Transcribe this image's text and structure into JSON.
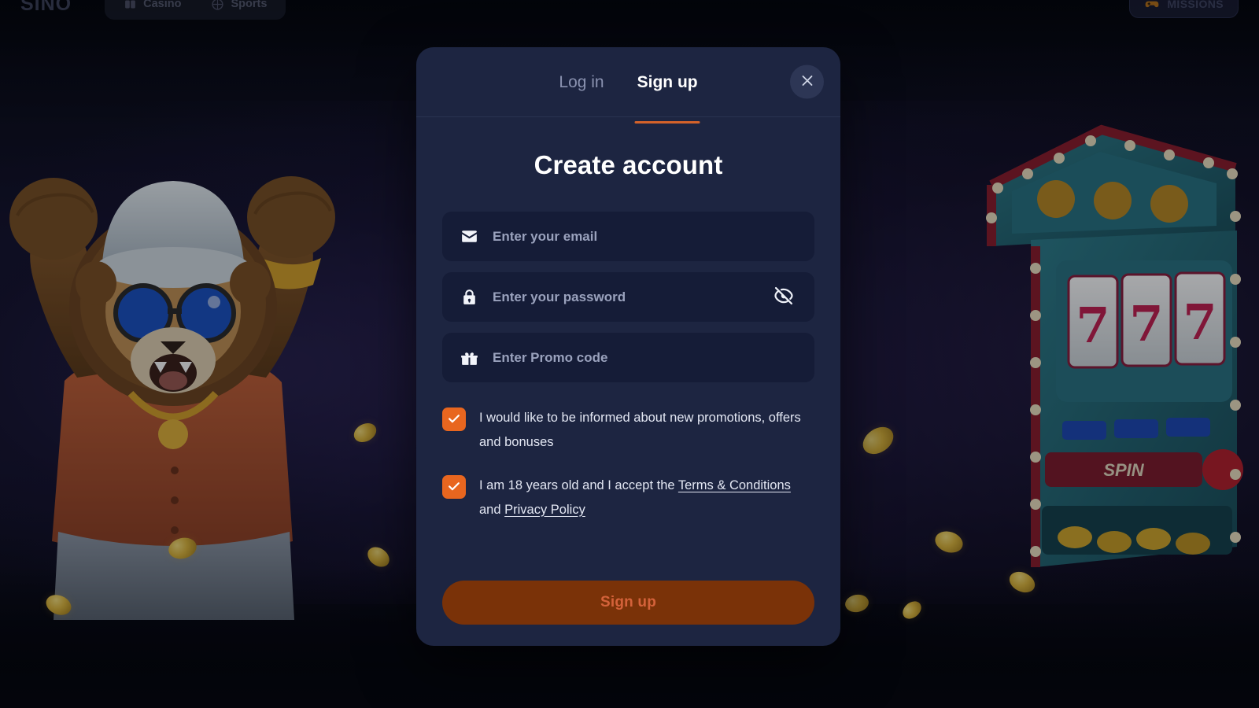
{
  "topnav": {
    "brand": "SINO",
    "items": [
      {
        "label": "Casino",
        "icon": "cards-icon"
      },
      {
        "label": "Sports",
        "icon": "ball-icon"
      }
    ],
    "missions": {
      "label": "MISSIONS",
      "icon": "gamepad-icon"
    }
  },
  "modal": {
    "tabs": [
      {
        "label": "Log in",
        "active": false
      },
      {
        "label": "Sign up",
        "active": true
      }
    ],
    "close_icon": "close-icon",
    "title": "Create account",
    "fields": [
      {
        "name": "email",
        "icon": "envelope-icon",
        "placeholder": "Enter your email",
        "value": ""
      },
      {
        "name": "password",
        "icon": "lock-icon",
        "placeholder": "Enter your password",
        "value": "",
        "toggle_icon": "eye-off-icon"
      },
      {
        "name": "promo",
        "icon": "gift-icon",
        "placeholder": "Enter Promo code",
        "value": ""
      }
    ],
    "consents": [
      {
        "checked": true,
        "text": "I would like to be informed about new promotions, offers and bonuses"
      },
      {
        "checked": true,
        "prefix": "I am 18 years old and I accept the ",
        "link1": "Terms & Conditions",
        "middle": " and ",
        "link2": "Privacy Policy"
      }
    ],
    "submit_label": "Sign up"
  },
  "colors": {
    "accent_orange": "#e8661f",
    "tab_underline": "#d4622a",
    "modal_bg": "#1d2541",
    "field_bg": "#151c37",
    "submit_bg": "#7a3208",
    "submit_text": "#d4623a",
    "page_bg": "#05060d"
  },
  "background": {
    "character": "lion-mascot",
    "slot_machine": {
      "reels": [
        "7",
        "7",
        "7"
      ],
      "spin_label": "SPIN"
    }
  }
}
